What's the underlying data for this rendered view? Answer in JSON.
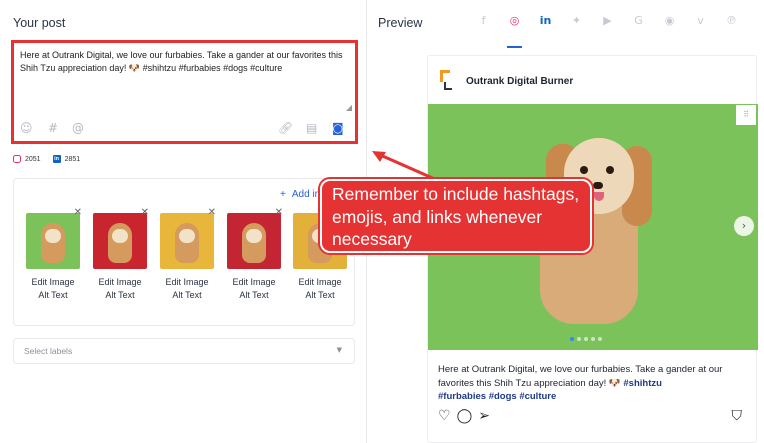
{
  "left": {
    "title": "Your post",
    "post_text": "Here at Outrank Digital, we love our furbabies. Take a gander at our favorites this Shih Tzu appreciation day! 🐶 #shihtzu #furbabies #dogs #culture",
    "tools": [
      "emoji-icon",
      "hashtag-icon",
      "mention-icon",
      "link-icon",
      "media-library-icon",
      "camera-icon"
    ],
    "counts": {
      "instagram": "2051",
      "linkedin": "2851"
    },
    "add_image_label": "Add im",
    "thumbs": [
      {
        "edit": "Edit Image",
        "alt": "Alt Text",
        "bg": "#7cc25a"
      },
      {
        "edit": "Edit Image",
        "alt": "Alt Text",
        "bg": "#c9252f"
      },
      {
        "edit": "Edit Image",
        "alt": "Alt Text",
        "bg": "#e8b63a"
      },
      {
        "edit": "Edit Image",
        "alt": "Alt Text",
        "bg": "#c32632"
      },
      {
        "edit": "Edit Image",
        "alt": "Alt Text",
        "bg": "#e3b13a"
      }
    ],
    "labels_placeholder": "Select labels"
  },
  "preview": {
    "title": "Preview",
    "tabs": [
      "facebook-icon",
      "instagram-icon",
      "linkedin-icon",
      "twitter-icon",
      "youtube-icon",
      "google-icon",
      "reddit-icon",
      "vimeo-icon",
      "pinterest-icon"
    ],
    "active_tab": "instagram",
    "brand_name": "Outrank Digital Burner",
    "caption_plain": "Here at Outrank Digital, we love our furbabies. Take a gander at our favorites this Shih Tzu appreciation day! 🐶 ",
    "caption_tags": [
      "#shihtzu",
      "#furbabies",
      "#dogs",
      "#culture"
    ]
  },
  "callout": {
    "text": "Remember to include hashtags, emojis, and links whenever necessary",
    "color": "#e53232"
  }
}
